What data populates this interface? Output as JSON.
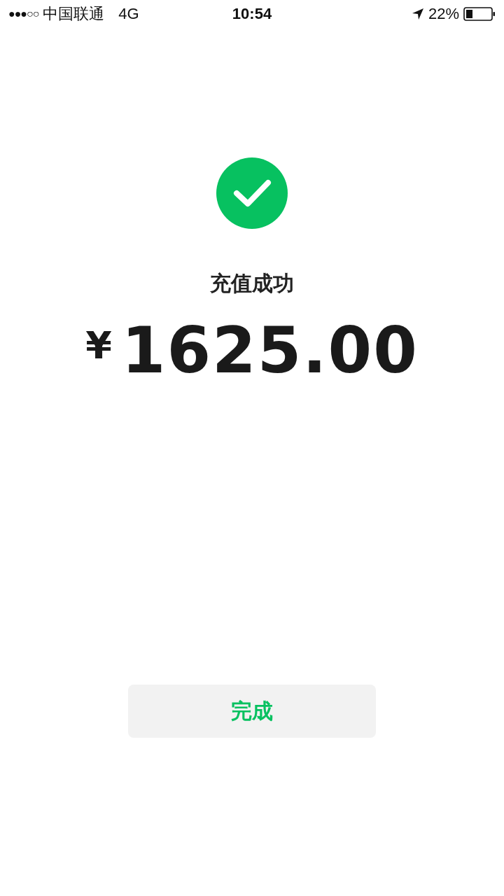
{
  "status_bar": {
    "signal": "●●●○○",
    "carrier": "中国联通",
    "network": "4G",
    "time": "10:54",
    "battery": "22%"
  },
  "result": {
    "title": "充值成功",
    "currency": "¥",
    "amount": "1625.00"
  },
  "button": {
    "label": "完成"
  }
}
